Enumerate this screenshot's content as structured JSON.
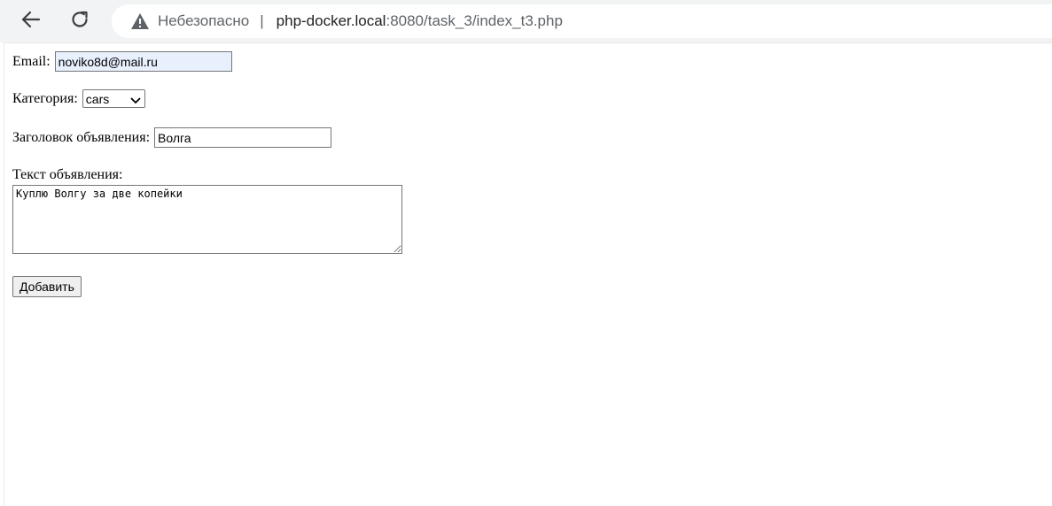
{
  "browser": {
    "back_icon": "arrow-left-icon",
    "reload_icon": "reload-icon",
    "security_icon": "warning-triangle-icon",
    "security_label": "Небезопасно",
    "url_separator": "|",
    "url_host": "php-docker.local",
    "url_rest": ":8080/task_3/index_t3.php"
  },
  "form": {
    "email_label": "Email:",
    "email_value": "noviko8d@mail.ru",
    "category_label": "Категория:",
    "category_selected": "cars",
    "title_label": "Заголовок объявления:",
    "title_value": "Волга",
    "text_label": "Текст объявления:",
    "text_value": "Куплю Волгу за две копейки",
    "submit_label": "Добавить"
  },
  "colors": {
    "autofill_background": "#e8f0fe",
    "toolbar_background": "#f1f3f4"
  }
}
